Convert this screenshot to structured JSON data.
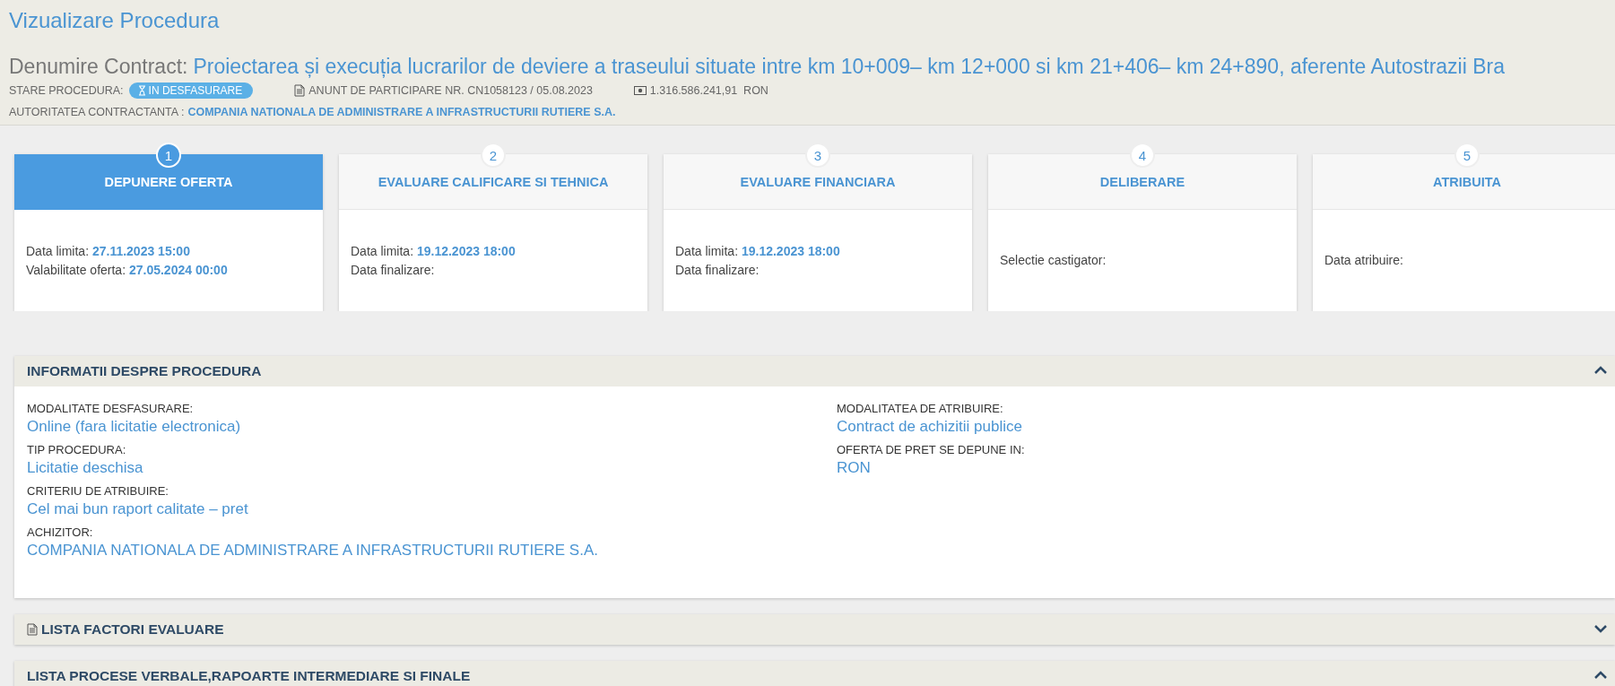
{
  "page_title": "Vizualizare Procedura",
  "contract": {
    "label": "Denumire Contract:",
    "name": "Proiectarea și execuția lucrarilor de deviere a traseului situate intre km 10+009– km 12+000 si km 21+406– km 24+890, aferente Autostrazii Bra"
  },
  "status": {
    "label": "STARE PROCEDURA:",
    "value": "IN DESFASURARE"
  },
  "notice": "ANUNT DE PARTICIPARE NR. CN1058123 / 05.08.2023",
  "amount": "1.316.586.241,91  RON",
  "authority": {
    "label": "AUTORITATEA CONTRACTANTA :",
    "value": "COMPANIA NATIONALA DE ADMINISTRARE A INFRASTRUCTURII RUTIERE S.A."
  },
  "steps": [
    {
      "number": "1",
      "title": "DEPUNERE OFERTA",
      "selected": true,
      "lines": [
        {
          "label": "Data limita:",
          "value": "27.11.2023 15:00"
        },
        {
          "label": "Valabilitate oferta:",
          "value": "27.05.2024 00:00"
        }
      ]
    },
    {
      "number": "2",
      "title": "EVALUARE CALIFICARE SI TEHNICA",
      "selected": false,
      "lines": [
        {
          "label": "Data limita:",
          "value": "19.12.2023 18:00"
        },
        {
          "label": "Data finalizare:"
        }
      ]
    },
    {
      "number": "3",
      "title": "EVALUARE FINANCIARA",
      "selected": false,
      "lines": [
        {
          "label": "Data limita:",
          "value": "19.12.2023 18:00"
        },
        {
          "label": "Data finalizare:"
        }
      ]
    },
    {
      "number": "4",
      "title": "DELIBERARE",
      "selected": false,
      "lines": [
        {
          "label": "Selectie castigator:"
        }
      ]
    },
    {
      "number": "5",
      "title": "ATRIBUITA",
      "selected": false,
      "lines": [
        {
          "label": "Data atribuire:"
        }
      ]
    }
  ],
  "sections": [
    {
      "title": "INFORMATII DESPRE PROCEDURA",
      "icon": false,
      "expanded": true,
      "columns": [
        [
          {
            "label": "MODALITATE DESFASURARE:",
            "value": "Online (fara licitatie electronica)"
          },
          {
            "label": "TIP PROCEDURA:",
            "value": "Licitatie deschisa"
          },
          {
            "label": "CRITERIU DE ATRIBUIRE:",
            "value": "Cel mai bun raport calitate – pret"
          },
          {
            "label": "ACHIZITOR:",
            "value": "COMPANIA NATIONALA DE ADMINISTRARE A INFRASTRUCTURII RUTIERE S.A."
          }
        ],
        [
          {
            "label": "MODALITATEA DE ATRIBUIRE:",
            "value": "Contract de achizitii publice"
          },
          {
            "label": "OFERTA DE PRET SE DEPUNE IN:",
            "value": "RON"
          }
        ]
      ]
    },
    {
      "title": "LISTA FACTORI EVALUARE",
      "icon": true,
      "expanded": false
    },
    {
      "title": "LISTA PROCESE VERBALE,RAPOARTE INTERMEDIARE SI FINALE",
      "icon": false,
      "expanded": true
    }
  ]
}
